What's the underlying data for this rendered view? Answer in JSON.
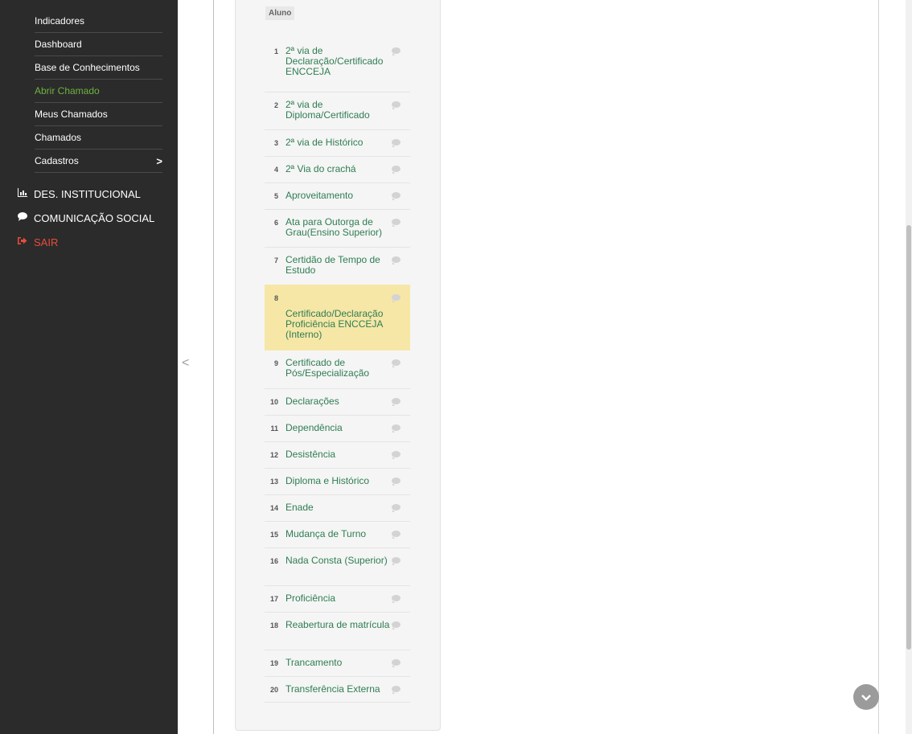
{
  "sidebar": {
    "sub_items": [
      {
        "label": "Indicadores",
        "active": false
      },
      {
        "label": "Dashboard",
        "active": false
      },
      {
        "label": "Base de Conhecimentos",
        "active": false
      },
      {
        "label": "Abrir Chamado",
        "active": true
      },
      {
        "label": "Meus Chamados",
        "active": false
      },
      {
        "label": "Chamados",
        "active": false
      },
      {
        "label": "Cadastros",
        "active": false
      }
    ],
    "cadastros_chevron": ">",
    "top_items": [
      {
        "label": "DES. INSTITUCIONAL",
        "icon": "bar-chart-icon"
      },
      {
        "label": "COMUNICAÇÃO SOCIAL",
        "icon": "comment-icon"
      },
      {
        "label": "SAIR",
        "icon": "sign-out-icon"
      }
    ],
    "active_color": "#6cb33f",
    "danger_color": "#e74c3c"
  },
  "gutter": {
    "collapse_arrow": "<"
  },
  "panel": {
    "category_label": "Aluno",
    "items": [
      {
        "num": "1",
        "label": "2ª via de Declaração/Certificado ENCCEJA"
      },
      {
        "num": "2",
        "label": "2ª via de Diploma/Certificado"
      },
      {
        "num": "3",
        "label": "2ª via de Histórico"
      },
      {
        "num": "4",
        "label": "2ª Via do crachá"
      },
      {
        "num": "5",
        "label": "Aproveitamento"
      },
      {
        "num": "6",
        "label": "Ata para Outorga de Grau(Ensino Superior)"
      },
      {
        "num": "7",
        "label": "Certidão de Tempo de Estudo"
      },
      {
        "num": "8",
        "label": "Certificado/Declaração Proficiência ENCCEJA (Interno)"
      },
      {
        "num": "9",
        "label": "Certificado de Pós/Especialização"
      },
      {
        "num": "10",
        "label": "Declarações"
      },
      {
        "num": "11",
        "label": "Dependência"
      },
      {
        "num": "12",
        "label": "Desistência"
      },
      {
        "num": "13",
        "label": "Diploma e Histórico"
      },
      {
        "num": "14",
        "label": "Enade"
      },
      {
        "num": "15",
        "label": "Mudança de Turno"
      },
      {
        "num": "16",
        "label": "Nada Consta (Superior)"
      },
      {
        "num": "17",
        "label": "Proficiência"
      },
      {
        "num": "18",
        "label": "Reabertura de matrícula"
      },
      {
        "num": "19",
        "label": "Trancamento"
      },
      {
        "num": "20",
        "label": "Transferência Externa"
      }
    ],
    "selected_num": "8",
    "highlight_color": "#f6e7a7",
    "link_color": "#2e7d52"
  },
  "scroll_top_icon": "chevron-down-icon"
}
